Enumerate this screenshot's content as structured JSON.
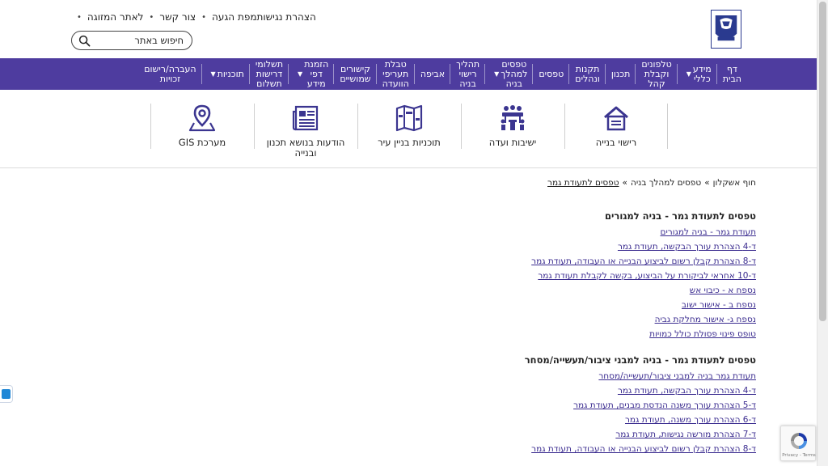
{
  "header": {
    "logo_alt": "עיריית אשקלון",
    "top_links": [
      "לאתר המזוגה",
      "צור קשר",
      "מפת הגעה",
      "הצהרת נגישות"
    ],
    "search_placeholder": "חיפוש באתר"
  },
  "nav": {
    "items": [
      {
        "label": "דף\nהבית",
        "dropdown": false
      },
      {
        "label": "מידע\nכללי",
        "dropdown": true
      },
      {
        "label": "טלפונים\nוקבלת\nקהל",
        "dropdown": false
      },
      {
        "label": "תכנון",
        "dropdown": false
      },
      {
        "label": "תקנות\nונהלים",
        "dropdown": false
      },
      {
        "label": "טפסים",
        "dropdown": false
      },
      {
        "label": "טפסים\nלמהלך\nבניה",
        "dropdown": true
      },
      {
        "label": "תהליך\nרישוי\nבניה",
        "dropdown": false
      },
      {
        "label": "אביפה",
        "dropdown": false
      },
      {
        "label": "טבלת\nתעריפי\nהוועדה",
        "dropdown": false
      },
      {
        "label": "קישורים\nשמושיים",
        "dropdown": false
      },
      {
        "label": "הזמנת\nדפי\nמידע",
        "dropdown": true
      },
      {
        "label": "תשלומי\nדרישות\nתשלום",
        "dropdown": false
      },
      {
        "label": "תוכניות",
        "dropdown": true
      },
      {
        "label": "העברה/רישום\nזכויות",
        "dropdown": false
      }
    ]
  },
  "tiles": [
    {
      "label": "רישוי בנייה",
      "icon": "house-icon"
    },
    {
      "label": "ישיבות ועדה",
      "icon": "meeting-icon"
    },
    {
      "label": "תוכניות בניין עיר",
      "icon": "map-book-icon"
    },
    {
      "label": "הודעות בנושא תכנון\nובנייה",
      "icon": "newspaper-icon"
    },
    {
      "label": "מערכת GIS",
      "icon": "map-pin-icon"
    }
  ],
  "breadcrumb": {
    "items": [
      "חוף אשקלון",
      "טפסים למהלך בניה",
      "טפסים לתעודת גמר"
    ],
    "separator": "»"
  },
  "sections": [
    {
      "title": "טפסים לתעודת גמר - בניה למגורים",
      "links": [
        "תעודת גמר - בניה למגורים",
        "ד-4 הצהרת עורך הבקשה, תעודת גמר",
        "ד-8 הצהרת קבלן רשום לביצוע הבנייה או העבודה, תעודת גמר",
        "ד-10 אחראי לביקורת על הביצוע, בקשה לקבלת תעודת גמר",
        "נספח א - כיבוי אש",
        "נספח ב - אישור ישוב",
        "נספח ג- אישור מחלקת גביה",
        "טופס פינוי פסולת כולל כמויות"
      ]
    },
    {
      "title": "טפסים לתעודת גמר - בניה למבני ציבור/תעשייה/מסחר",
      "links": [
        "תעודת גמר בניה למבני ציבור/תעשייה/מסחר",
        "ד-4 הצהרת עורך הבקשה, תעודת גמר",
        "ד-5 הצהרת עורך משנה הנדסת מבנים, תעודת גמר",
        "ד-6 הצהרת עורך משנה, תעודת גמר",
        "ד-7 הצהרת מורשה נגישות, תעודת גמר",
        "ד-8 הצהרת קבלן רשום לביצוע הבנייה או העבודה, תעודת גמר"
      ]
    }
  ],
  "recaptcha": {
    "text": "Privacy - Terms"
  },
  "colors": {
    "nav_bg": "#4e3c9f",
    "link": "#3a2b8f",
    "icon": "#3b3590"
  }
}
